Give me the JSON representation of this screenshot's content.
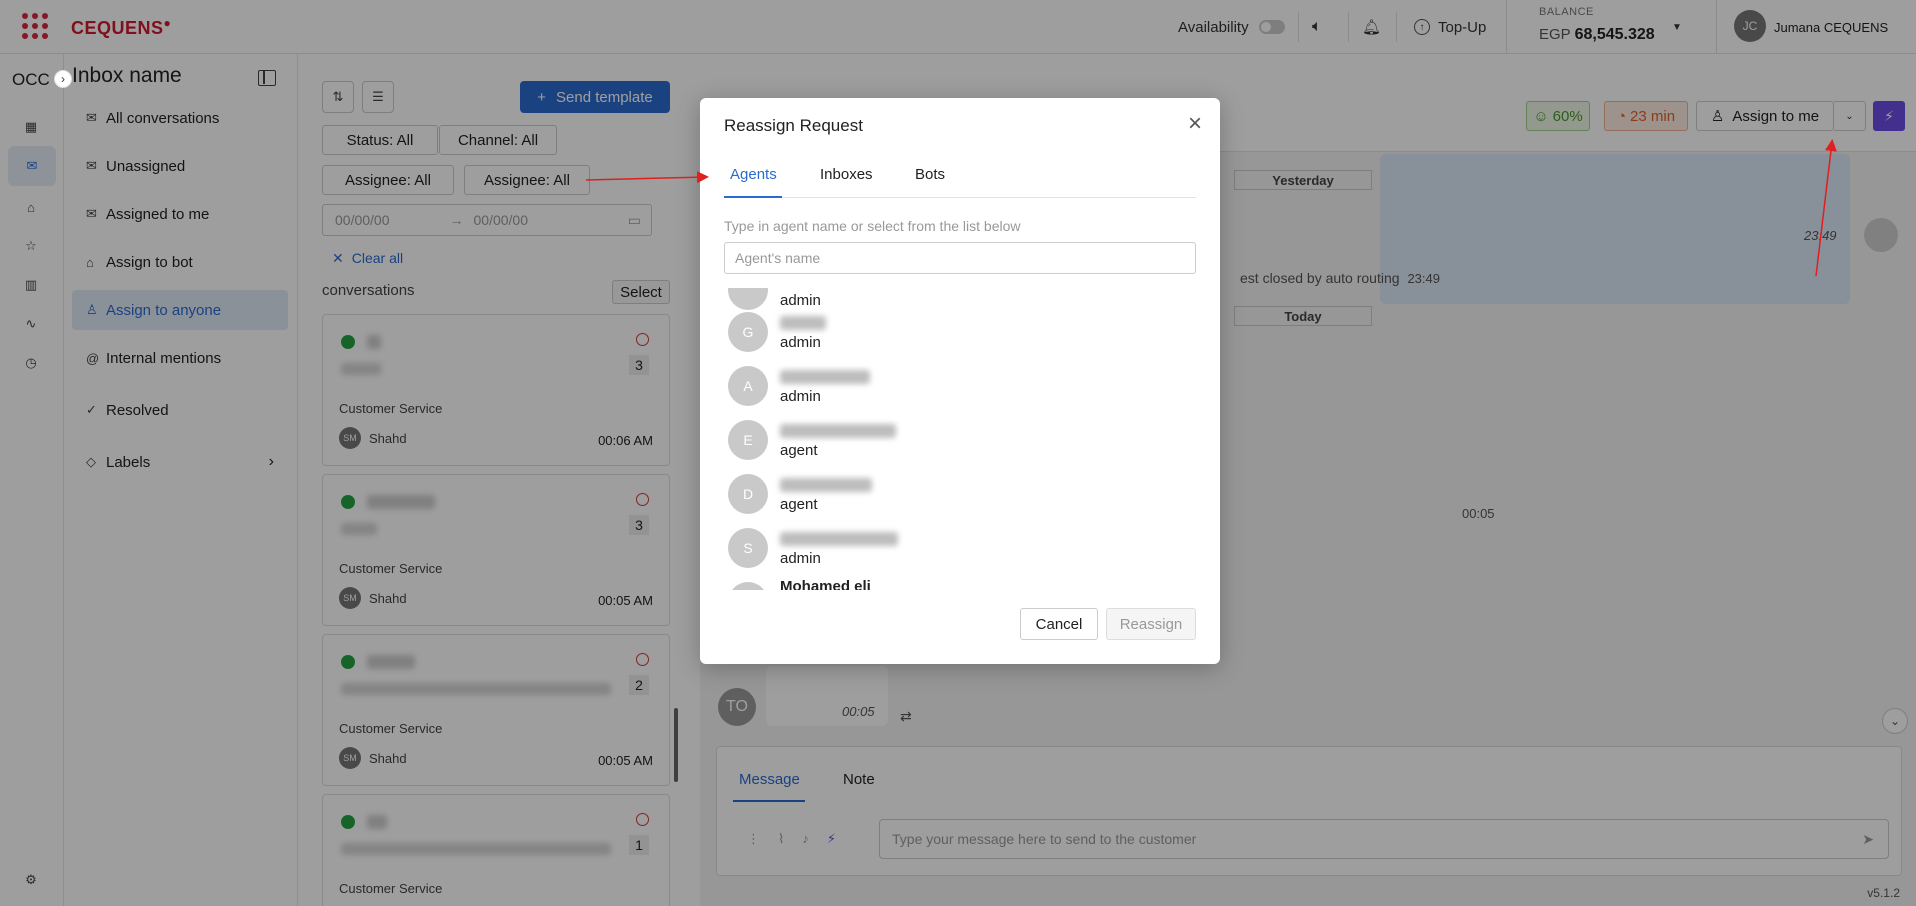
{
  "topbar": {
    "brand": "CEQUENS",
    "availability_label": "Availability",
    "topup_label": "Top-Up",
    "balance_label": "BALANCE",
    "balance_currency": "EGP",
    "balance_value": "68,545.328",
    "user_initials": "JC",
    "user_name": "Jumana CEQUENS"
  },
  "rail": {
    "workspace": "OCC"
  },
  "inbox": {
    "title": "Inbox name",
    "items": [
      {
        "label": "All conversations",
        "icon": "envelope-icon"
      },
      {
        "label": "Unassigned",
        "icon": "envelope-icon"
      },
      {
        "label": "Assigned to me",
        "icon": "envelope-icon"
      },
      {
        "label": "Assign to bot",
        "icon": "bot-icon"
      },
      {
        "label": "Assign to anyone",
        "icon": "user-icon",
        "active": true
      },
      {
        "label": "Internal mentions",
        "icon": "at-icon"
      },
      {
        "label": "Resolved",
        "icon": "check-circle-icon"
      },
      {
        "label": "Labels",
        "icon": "tag-icon"
      }
    ]
  },
  "conversations": {
    "send_template_label": "Send template",
    "filters": {
      "status": "Status:  All",
      "channel": "Channel:  All",
      "assignee1": "Assignee:  All",
      "assignee2": "Assignee:  All"
    },
    "date_from_placeholder": "00/00/00",
    "date_to_placeholder": "00/00/00",
    "clear_all": "Clear all",
    "list_label": "conversations",
    "select_label": "Select",
    "cards": [
      {
        "service": "Customer Service",
        "agent_initials": "SM",
        "agent": "Shahd",
        "time": "00:06 AM",
        "count": "3"
      },
      {
        "service": "Customer Service",
        "agent_initials": "SM",
        "agent": "Shahd",
        "time": "00:05 AM",
        "count": "3"
      },
      {
        "service": "Customer Service",
        "agent_initials": "SM",
        "agent": "Shahd",
        "time": "00:05 AM",
        "count": "2"
      },
      {
        "service": "Customer Service",
        "agent_initials": "",
        "agent": "",
        "time": "",
        "count": "1"
      }
    ]
  },
  "chat": {
    "sla_percent": "60%",
    "sla_time": "23 min",
    "assign_to_me": "Assign to me",
    "day_yesterday": "Yesterday",
    "day_today": "Today",
    "msg_time_1": "23:49",
    "system_message": "est closed by auto routing",
    "system_time": "23:49",
    "msg_time_2": "00:05",
    "msg_time_3": "00:05",
    "sender_initials": "TO",
    "composer_tabs": [
      "Message",
      "Note"
    ],
    "composer_placeholder": "Type your message here to send to the customer",
    "version": "v5.1.2"
  },
  "modal": {
    "title": "Reassign Request",
    "tabs": [
      "Agents",
      "Inboxes",
      "Bots"
    ],
    "hint": "Type in agent name or select from the list below",
    "search_placeholder": "Agent's name",
    "agents": [
      {
        "initial": "",
        "role": "admin"
      },
      {
        "initial": "G",
        "role": "admin"
      },
      {
        "initial": "A",
        "role": "admin"
      },
      {
        "initial": "E",
        "role": "agent"
      },
      {
        "initial": "D",
        "role": "agent"
      },
      {
        "initial": "S",
        "role": "admin"
      },
      {
        "initial": "",
        "role": "Mohamed eli"
      }
    ],
    "cancel_label": "Cancel",
    "reassign_label": "Reassign"
  },
  "colors": {
    "brand_red": "#d0192f",
    "accent_blue": "#2a6bd1",
    "bolt_purple": "#6b4de6",
    "sla_green": "#4a9a2a",
    "sla_orange": "#e0632b"
  }
}
